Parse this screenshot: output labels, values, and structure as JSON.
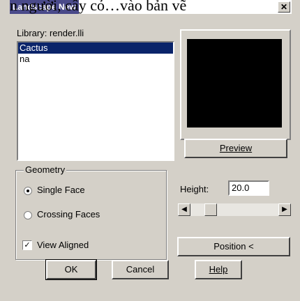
{
  "window": {
    "title": "Landscape New",
    "overlay_text": "n người, cây cỏ…vào bản vẽ",
    "close_label": "✕"
  },
  "library": {
    "label": "Library: render.lli",
    "items": [
      {
        "label": "Cactus",
        "selected": true
      },
      {
        "label": "na",
        "selected": false
      }
    ]
  },
  "preview": {
    "button_label": "Preview"
  },
  "geometry": {
    "title": "Geometry",
    "single_face": "Single Face",
    "crossing_faces": "Crossing Faces",
    "selected": "single_face",
    "view_aligned": "View Aligned",
    "view_aligned_checked": true
  },
  "height": {
    "label": "Height:",
    "value": "20.0"
  },
  "position_button": "Position <",
  "buttons": {
    "ok": "OK",
    "cancel": "Cancel",
    "help": "Help"
  },
  "colors": {
    "dialog_bg": "#d4d0c8",
    "selection": "#0a246a"
  }
}
